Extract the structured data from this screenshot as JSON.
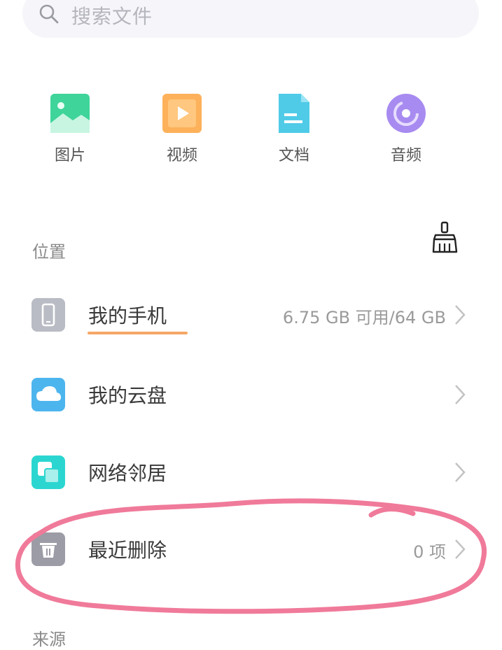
{
  "search": {
    "placeholder": "搜索文件",
    "icon": "search-icon"
  },
  "categories": [
    {
      "label": "图片",
      "icon": "image-icon",
      "color": "#3ed49a"
    },
    {
      "label": "视频",
      "icon": "video-icon",
      "color": "#fdb15a"
    },
    {
      "label": "文档",
      "icon": "document-icon",
      "color": "#4fcbe8"
    },
    {
      "label": "音频",
      "icon": "audio-icon",
      "color": "#a88bf0"
    }
  ],
  "location_section": {
    "title": "位置",
    "clean_icon": "broom-icon"
  },
  "locations": [
    {
      "name": "我的手机",
      "info": "6.75 GB 可用/64 GB",
      "icon": "phone-icon",
      "color": "#b9bcc4"
    },
    {
      "name": "我的云盘",
      "info": "",
      "icon": "cloud-icon",
      "color": "#4db5ee"
    },
    {
      "name": "网络邻居",
      "info": "",
      "icon": "network-icon",
      "color": "#2cd6d0"
    },
    {
      "name": "最近删除",
      "info": "0 项",
      "icon": "trash-icon",
      "color": "#9c9ca6"
    }
  ],
  "source_section": {
    "title": "来源"
  },
  "colors": {
    "annotation": "#f07a9a",
    "storage_bar": "#f5a766"
  }
}
